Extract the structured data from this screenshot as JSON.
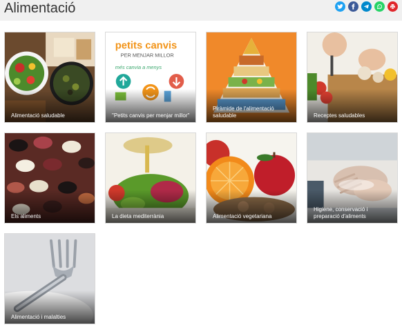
{
  "page": {
    "title": "Alimentació"
  },
  "share": [
    {
      "name": "twitter-icon",
      "color": "#1da1f2"
    },
    {
      "name": "facebook-icon",
      "color": "#3b5998"
    },
    {
      "name": "telegram-icon",
      "color": "#0088cc"
    },
    {
      "name": "whatsapp-icon",
      "color": "#25d366"
    },
    {
      "name": "print-icon",
      "color": "#e0252a"
    }
  ],
  "tiles": [
    {
      "label": "Alimentació saludable",
      "icon": "salad-image"
    },
    {
      "label": "\"Petits canvis per menjar millor\"",
      "icon": "petits-canvis-image",
      "poster": {
        "l1": "petits canvis",
        "l2": "PER MENJAR MILLOR",
        "l3": "més  canvia a  menys"
      }
    },
    {
      "label": "Piràmide de l'alimentació saludable",
      "icon": "food-pyramid-image"
    },
    {
      "label": "Receptes saludables",
      "icon": "cooking-image"
    },
    {
      "label": "Els aliments",
      "icon": "beans-image"
    },
    {
      "label": "La dieta mediterrània",
      "icon": "olive-oil-image"
    },
    {
      "label": "Alimentació vegetariana",
      "icon": "fruits-image"
    },
    {
      "label": "Higiene, conservació i preparació d'aliments",
      "icon": "hand-washing-image"
    },
    {
      "label": "Alimentació i malalties",
      "icon": "fork-image"
    }
  ]
}
